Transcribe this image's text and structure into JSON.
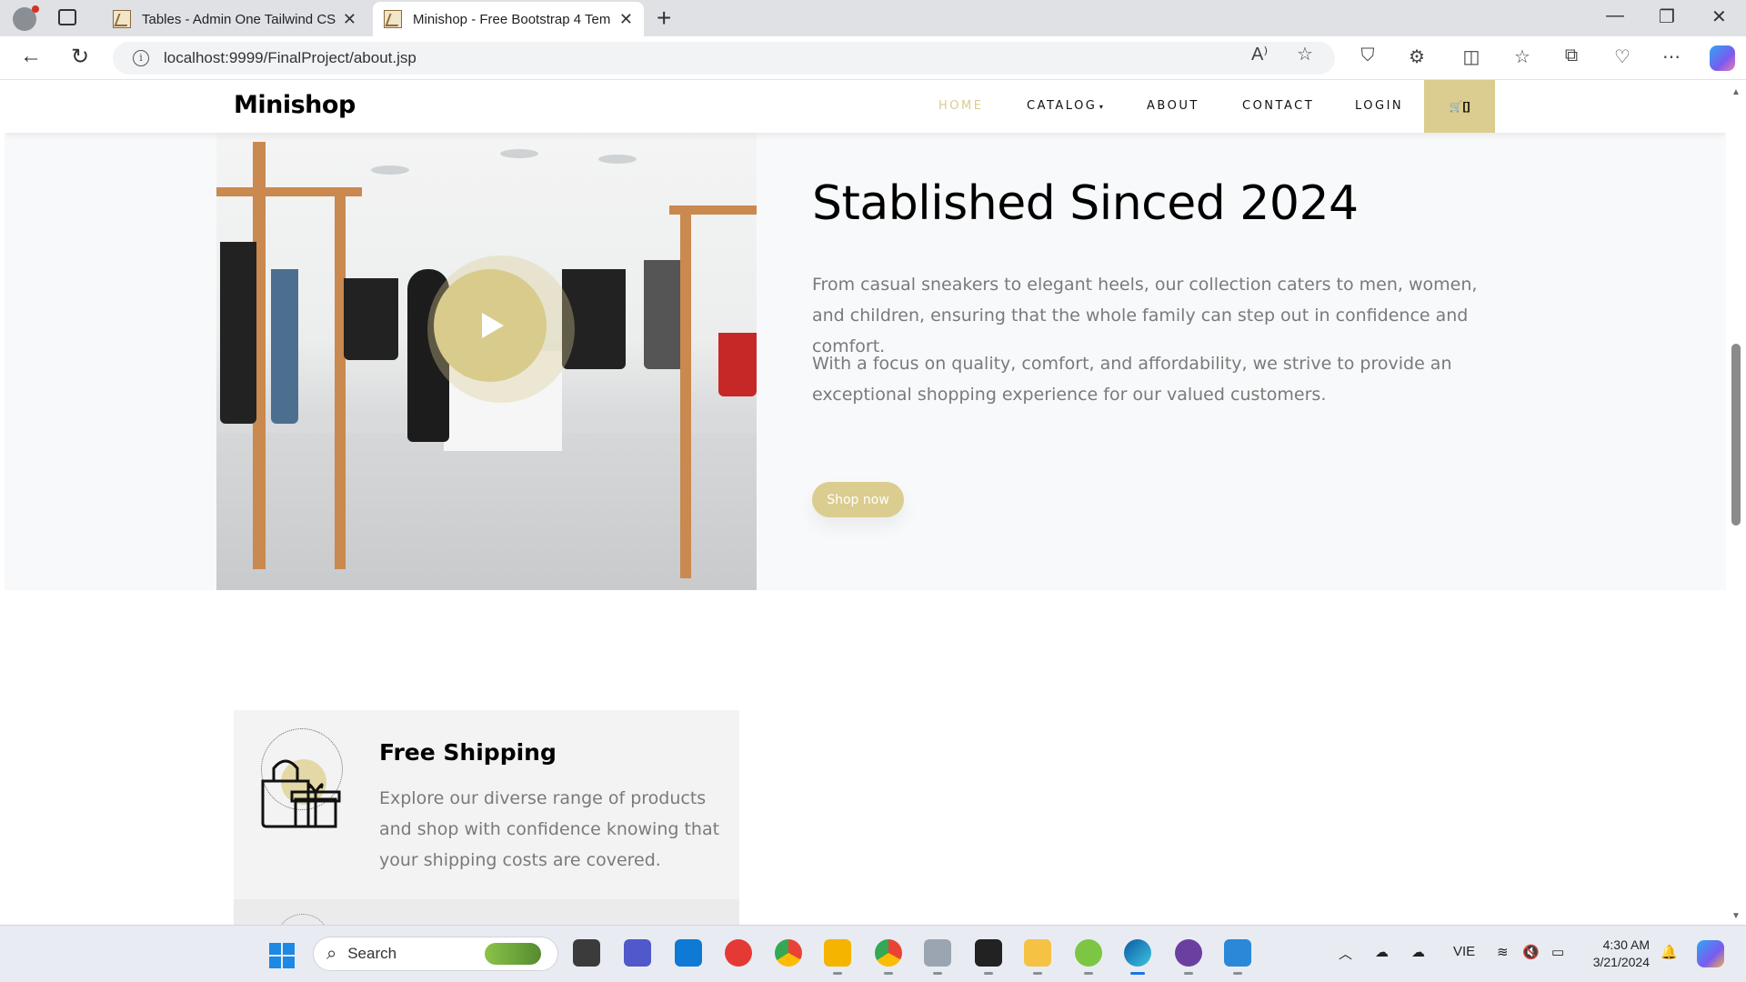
{
  "browser": {
    "tabs": [
      {
        "title": "Tables - Admin One Tailwind CSS"
      },
      {
        "title": "Minishop - Free Bootstrap 4 Tem"
      }
    ],
    "url": "localhost:9999/FinalProject/about.jsp"
  },
  "site": {
    "brand": "Minishop",
    "nav": {
      "home": "HOME",
      "catalog": "CATALOG",
      "about": "ABOUT",
      "contact": "CONTACT",
      "login": "LOGIN",
      "cart": "[]"
    },
    "accent_color": "#dbcc8f"
  },
  "about": {
    "heading": "Stablished Sinced 2024",
    "paragraph1": "From casual sneakers to elegant heels, our collection caters to men, women, and children, ensuring that the whole family can step out in confidence and comfort.",
    "paragraph2": "With a focus on quality, comfort, and affordability, we strive to provide an exceptional shopping experience for our valued customers.",
    "shop_button": "Shop now"
  },
  "services": [
    {
      "icon": "shopping-bag-gift-icon",
      "title": "Free Shipping",
      "description": "Explore our diverse range of products and shop with confidence knowing that your shipping costs are covered."
    }
  ],
  "taskbar": {
    "search_placeholder": "Search",
    "language": "VIE",
    "time": "4:30 AM",
    "date": "3/21/2024"
  }
}
